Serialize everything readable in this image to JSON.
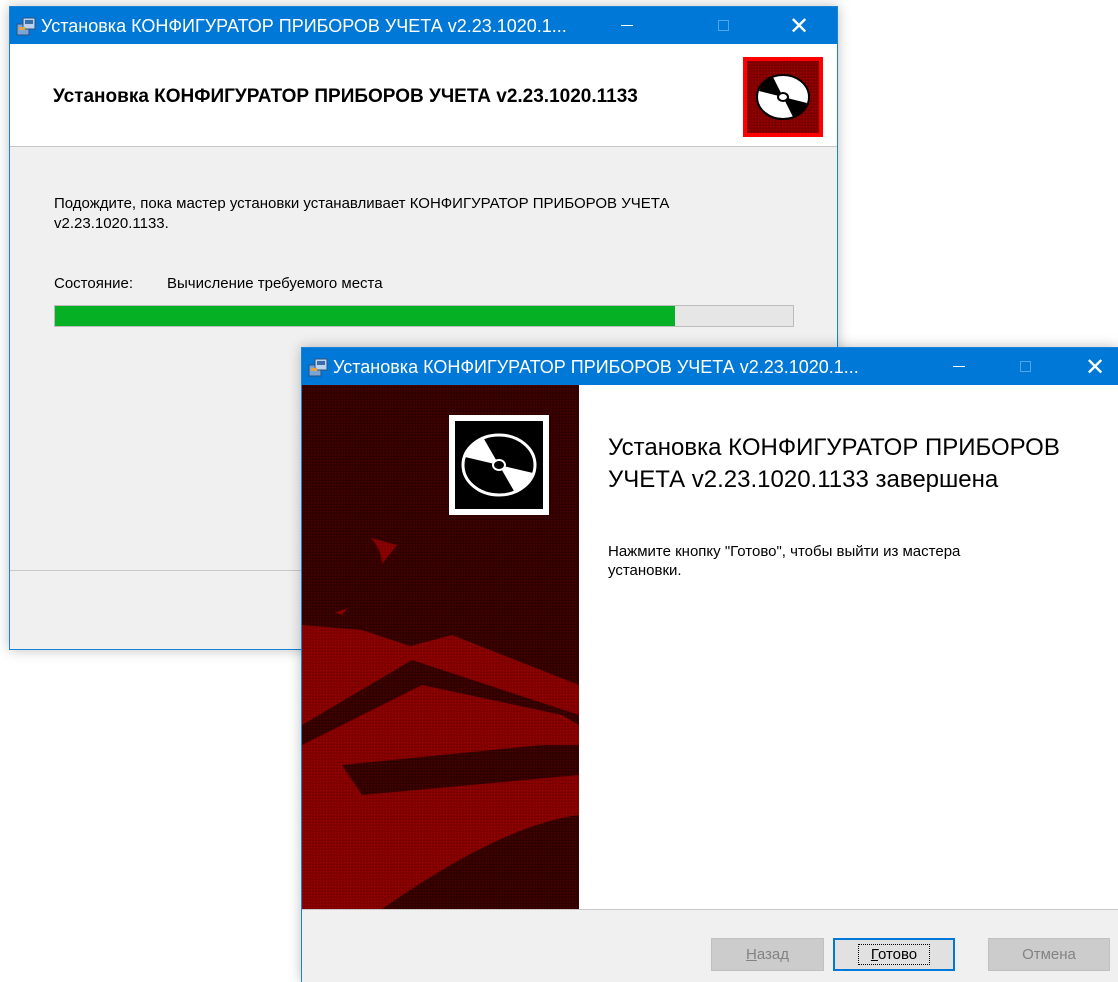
{
  "installer_progress": {
    "window_title": "Установка КОНФИГУРАТОР ПРИБОРОВ УЧЕТА v2.23.1020.1...",
    "header_title": "Установка КОНФИГУРАТОР ПРИБОРОВ УЧЕТА v2.23.1020.1133",
    "message": "Подождите, пока мастер установки устанавливает КОНФИГУРАТОР ПРИБОРОВ УЧЕТА v2.23.1020.1133.",
    "status_label": "Состояние:",
    "status_value": "Вычисление требуемого места",
    "progress_percent": 84,
    "progress_color": "#06b025",
    "icons": {
      "app": "installer-package-icon",
      "logo": "cd-disc-icon"
    }
  },
  "installer_complete": {
    "window_title": "Установка КОНФИГУРАТОР ПРИБОРОВ УЧЕТА v2.23.1020.1...",
    "heading": "Установка КОНФИГУРАТОР ПРИБОРОВ УЧЕТА v2.23.1020.1133 завершена",
    "message": "Нажмите кнопку \"Готово\", чтобы выйти из мастера установки.",
    "buttons": {
      "back": {
        "mnemonic": "Н",
        "rest": "азад",
        "enabled": false
      },
      "finish": {
        "mnemonic": "Г",
        "rest": "отово",
        "enabled": true
      },
      "cancel": {
        "label": "Отмена",
        "enabled": false
      }
    },
    "side_art_colors": {
      "dark": "#3a0000",
      "accent": "#8a0000"
    },
    "icons": {
      "app": "installer-package-icon",
      "logo": "cd-disc-icon"
    }
  },
  "titlebar_color": "#0078d7"
}
